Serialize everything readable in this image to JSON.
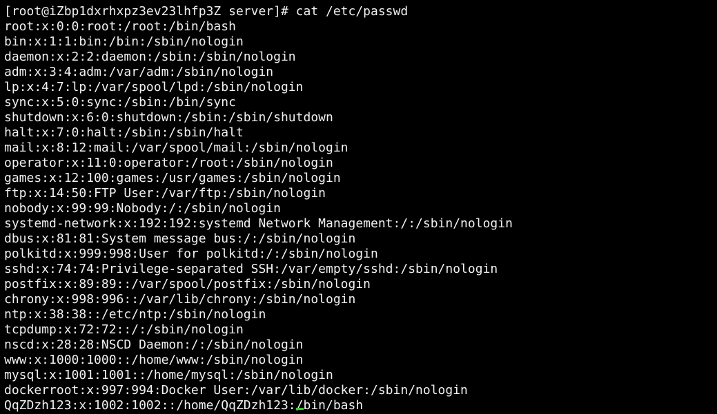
{
  "terminal": {
    "prompt": "[root@iZbp1dxrhxpz3ev23lhfp3Z server]# cat /etc/passwd",
    "lines": [
      "root:x:0:0:root:/root:/bin/bash",
      "bin:x:1:1:bin:/bin:/sbin/nologin",
      "daemon:x:2:2:daemon:/sbin:/sbin/nologin",
      "adm:x:3:4:adm:/var/adm:/sbin/nologin",
      "lp:x:4:7:lp:/var/spool/lpd:/sbin/nologin",
      "sync:x:5:0:sync:/sbin:/bin/sync",
      "shutdown:x:6:0:shutdown:/sbin:/sbin/shutdown",
      "halt:x:7:0:halt:/sbin:/sbin/halt",
      "mail:x:8:12:mail:/var/spool/mail:/sbin/nologin",
      "operator:x:11:0:operator:/root:/sbin/nologin",
      "games:x:12:100:games:/usr/games:/sbin/nologin",
      "ftp:x:14:50:FTP User:/var/ftp:/sbin/nologin",
      "nobody:x:99:99:Nobody:/:/sbin/nologin",
      "systemd-network:x:192:192:systemd Network Management:/:/sbin/nologin",
      "dbus:x:81:81:System message bus:/:/sbin/nologin",
      "polkitd:x:999:998:User for polkitd:/:/sbin/nologin",
      "sshd:x:74:74:Privilege-separated SSH:/var/empty/sshd:/sbin/nologin",
      "postfix:x:89:89::/var/spool/postfix:/sbin/nologin",
      "chrony:x:998:996::/var/lib/chrony:/sbin/nologin",
      "ntp:x:38:38::/etc/ntp:/sbin/nologin",
      "tcpdump:x:72:72::/:/sbin/nologin",
      "nscd:x:28:28:NSCD Daemon:/:/sbin/nologin",
      "www:x:1000:1000::/home/www:/sbin/nologin",
      "mysql:x:1001:1001::/home/mysql:/sbin/nologin",
      "dockerroot:x:997:994:Docker User:/var/lib/docker:/sbin/nologin"
    ],
    "last_line_before_cursor": "QqZDzh123:x:1002:1002::/home/QqZDzh123:",
    "last_line_after_cursor": "/bin/bash",
    "colors": {
      "background": "#000000",
      "text": "#f0f0f0",
      "cursor": "#33cc33"
    }
  }
}
